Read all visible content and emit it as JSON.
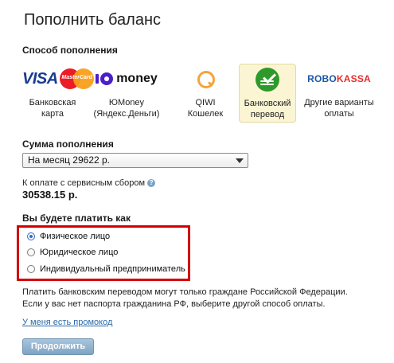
{
  "page": {
    "title": "Пополнить баланс"
  },
  "methods": {
    "label": "Способ пополнения",
    "items": [
      {
        "line1": "Банковская карта",
        "line2": "",
        "logo": "VISA",
        "logo2": "MasterCard",
        "selected": false
      },
      {
        "line1": "ЮMoney",
        "line2": "(Яндекс.Деньги)",
        "logo": "money",
        "selected": false
      },
      {
        "line1": "QIWI",
        "line2": "Кошелек",
        "logo": "qiwi-icon",
        "selected": false
      },
      {
        "line1": "Банковский",
        "line2": "перевод",
        "logo": "sberbank-icon",
        "selected": true
      },
      {
        "line1": "Другие варианты",
        "line2": "оплаты",
        "logo_a": "ROBO",
        "logo_b": "KASSA",
        "selected": false
      }
    ]
  },
  "amount": {
    "label": "Сумма пополнения",
    "selected_option": "На месяц 29622 р.",
    "fee_label": "К оплате с сервисным сбором",
    "total": "30538.15 р."
  },
  "payer": {
    "label": "Вы будете платить как",
    "options": [
      {
        "label": "Физическое лицо",
        "checked": true
      },
      {
        "label": "Юридическое лицо",
        "checked": false
      },
      {
        "label": "Индивидуальный предприниматель",
        "checked": false
      }
    ],
    "highlight_color": "#d40000"
  },
  "note": {
    "line1": "Платить банковским переводом могут только граждане Российской Федерации.",
    "line2": "Если у вас нет паспорта гражданина РФ, выберите другой способ оплаты."
  },
  "promo_link": "У меня есть промокод",
  "continue_label": "Продолжить"
}
